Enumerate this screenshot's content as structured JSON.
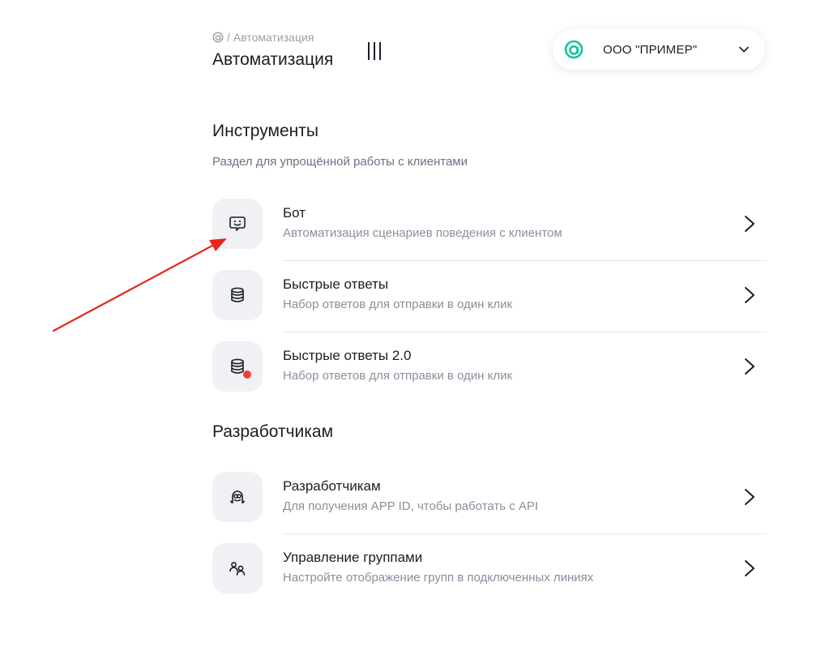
{
  "header": {
    "breadcrumb_sep": "/",
    "breadcrumb_current": "Автоматизация",
    "title": "Автоматизация"
  },
  "org_selector": {
    "name": "ООО \"ПРИМЕР\"",
    "logo_color": "#17c3a0"
  },
  "tools_section": {
    "title": "Инструменты",
    "description": "Раздел для упрощённой работы с клиентами",
    "items": [
      {
        "title": "Бот",
        "subtitle": "Автоматизация сценариев поведения с клиентом",
        "icon": "bot-icon"
      },
      {
        "title": "Быстрые ответы",
        "subtitle": "Набор ответов для отправки в один клик",
        "icon": "database-icon"
      },
      {
        "title": "Быстрые ответы 2.0",
        "subtitle": "Набор ответов для отправки в один клик",
        "icon": "database-new-icon"
      }
    ]
  },
  "dev_section": {
    "title": "Разработчикам",
    "items": [
      {
        "title": "Разработчикам",
        "subtitle": "Для получения APP ID, чтобы работать с API",
        "icon": "developer-mascot-icon"
      },
      {
        "title": "Управление группами",
        "subtitle": "Настройте отображение групп в подключенных линиях",
        "icon": "users-group-icon"
      }
    ]
  },
  "colors": {
    "new_badge": "#f04040",
    "annotation_arrow": "#e8241b"
  }
}
